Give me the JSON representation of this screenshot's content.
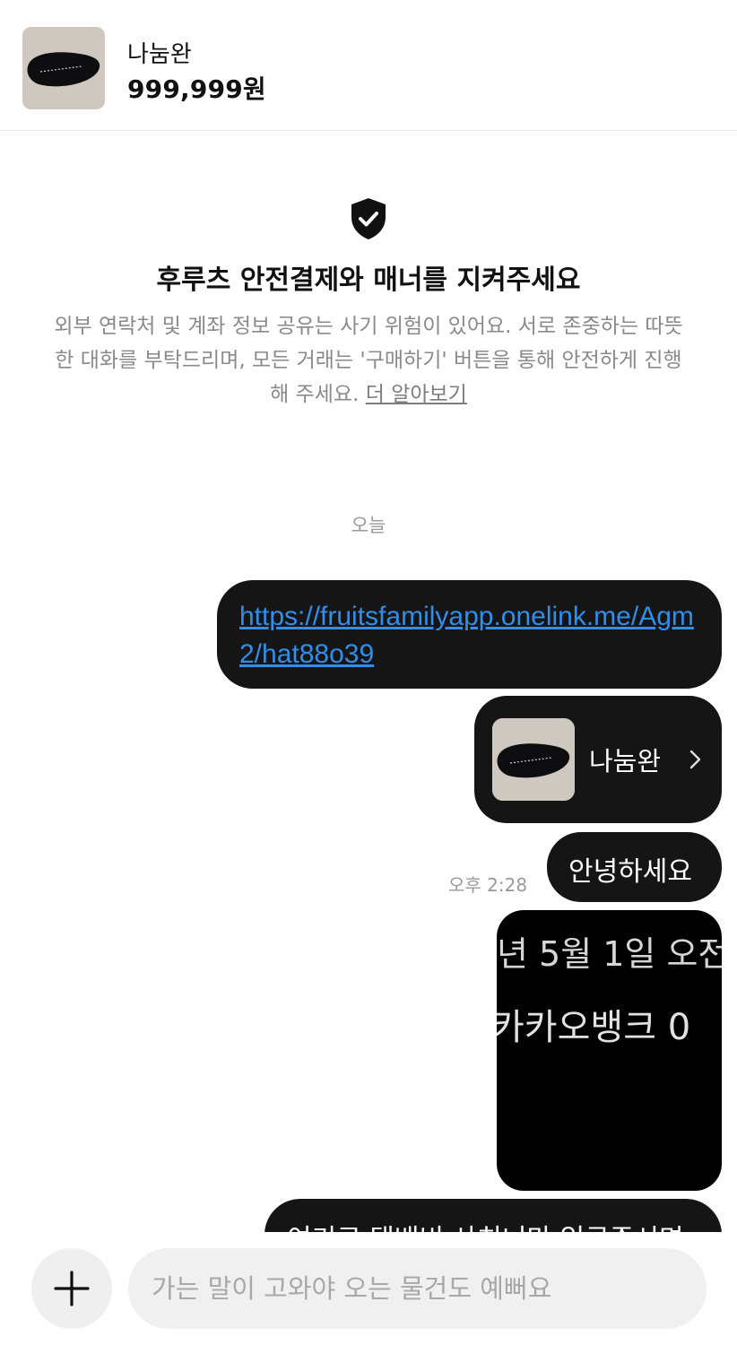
{
  "product": {
    "title": "나눔완",
    "price": "999,999원"
  },
  "notice": {
    "icon": "shield-check-icon",
    "title": "후루츠 안전결제와 매너를 지켜주세요",
    "body": "외부 연락처 및 계좌 정보 공유는 사기 위험이 있어요. 서로 존중하는 따뜻한 대화를 부탁드리며, 모든 거래는 '구매하기' 버튼을 통해 안전하게 진행해 주세요.",
    "link_label": "더 알아보기"
  },
  "day_divider": "오늘",
  "messages": {
    "link_text": "https://fruitsfamilyapp.onelink.me/Agm2/hat88o39",
    "card_title": "나눔완",
    "greeting": "안녕하세요",
    "greeting_time": "오후 2:28",
    "image_text_line1": "년 5월 1일 오전",
    "image_text_line2": "카카오뱅크 0",
    "partial_text": "여기로 택배비 사치너만 입금주시면"
  },
  "composer": {
    "placeholder": "가는 말이 고와야 오는 물건도 예뻐요"
  },
  "colors": {
    "bubble": "#151515",
    "link": "#2f8fea",
    "muted": "#8a8a8a"
  }
}
